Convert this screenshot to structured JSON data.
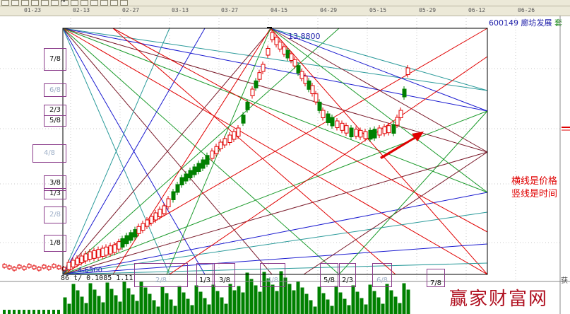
{
  "toolbar": {
    "icons": [
      "save-icon",
      "print-icon",
      "copy-icon",
      "undo-icon",
      "chart-icon",
      "grid-icon",
      "percent-icon",
      "indicator-icon",
      "zoom-icon",
      "pen-icon",
      "settings-icon",
      "window-icon",
      "info-icon"
    ],
    "percent_label": "%"
  },
  "date_axis": [
    "01-23",
    "02-13",
    "02-27",
    "03-13",
    "03-27",
    "04-15",
    "04-29",
    "05-15",
    "05-29",
    "06-12",
    "06-26"
  ],
  "stock": {
    "code": "600149",
    "name": "廊坊发展",
    "cut_text": "套"
  },
  "price_high": "13.8800",
  "price_low": "4.6500",
  "volume_readout": "86 t/ 0.1085 1.11",
  "left_levels": [
    {
      "label": "7/8",
      "faint": false
    },
    {
      "label": "6/8",
      "faint": true
    },
    {
      "label": "2/3",
      "faint": false
    },
    {
      "label": "5/8",
      "faint": false
    },
    {
      "label": "4/8",
      "faint": true
    },
    {
      "label": "3/8",
      "faint": false
    },
    {
      "label": "1/3",
      "faint": false
    },
    {
      "label": "2/8",
      "faint": true
    },
    {
      "label": "1/8",
      "faint": false
    }
  ],
  "bottom_levels": [
    {
      "label": "2/8",
      "faint": true
    },
    {
      "label": "1/3",
      "faint": false
    },
    {
      "label": "3/8",
      "faint": false
    },
    {
      "label": "4/8",
      "faint": true
    },
    {
      "label": "5/8",
      "faint": false
    },
    {
      "label": "2/3",
      "faint": false
    },
    {
      "label": "6/8",
      "faint": true
    },
    {
      "label": "7/8",
      "faint": false
    }
  ],
  "annotation": {
    "line1": "横线是价格",
    "line2": "竖线是时间"
  },
  "watermark": "赢家财富网",
  "right_tag": "获",
  "colors": {
    "up": "#e00000",
    "down": "#008000",
    "frame": "#000000",
    "arrow": "#e00000",
    "grid": "#b0b0b0"
  }
}
